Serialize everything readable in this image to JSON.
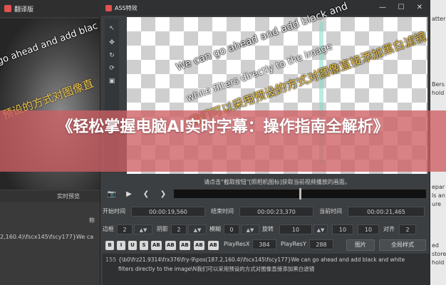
{
  "bg_app": {
    "title": "翻译版",
    "subtitle_en": "go ahead and add blac filters directly to the",
    "subtitle_cn": "预设的方式对图像直",
    "status_label": "实时预览",
    "field_label": "称",
    "code_fragment": "2,160.4)\\fscx145\\fscy177}We ca"
  },
  "bg_right": {
    "lines": [
      "atter",
      "Bers",
      "hold",
      "epar",
      "ls an",
      "ure",
      "ed",
      "store",
      "hold"
    ]
  },
  "dialog": {
    "title": "ASS特效",
    "win_min": "—",
    "win_max": "☐",
    "win_close": "✕",
    "tools": [
      "↖",
      "✥",
      "↻",
      "⟳",
      "▣"
    ]
  },
  "canvas": {
    "subtitle_line1": "We can go ahead and add black and",
    "subtitle_line2": "white filters directly to the image",
    "subtitle_line3": "我们可以采用预设的方式对图像直接添加黑白滤镜"
  },
  "hint": "请点击\"截取按钮\"[照相机图标]获取当前视频播放的画面。",
  "player": {
    "camera": "📷",
    "play": "▶",
    "prev": "❮",
    "next": "❯"
  },
  "times": {
    "start_label": "开始时间",
    "start_value": "00:00:19,560",
    "end_label": "结束时间",
    "end_value": "00:00:23,370",
    "current_label": "当前时间",
    "current_value": "00:00:21,465"
  },
  "props": {
    "border_label": "边框",
    "border_value": "2",
    "shadow_label": "阴影",
    "shadow_value": "2",
    "blur_label": "模糊",
    "blur_value": "0",
    "rotate_label": "旋转",
    "rotate_value": "10",
    "rotate_value2": "10",
    "rotate_value3": "10",
    "align_label": "对齐",
    "align_value": "2"
  },
  "format": {
    "buttons": [
      "B",
      "I",
      "U",
      "S",
      "AB",
      "AB",
      "AB",
      "AB",
      "AB"
    ],
    "playresx_label": "PlayResX",
    "playresx_value": "384",
    "playresy_label": "PlayResY",
    "playresy_value": "288",
    "image_btn": "图片",
    "fullstyle_btn": "全局样式"
  },
  "editor": {
    "line_no": "155",
    "code_line1": "{\\b0\\frz21.9314\\frx376\\fry-9\\pos(187.2,160.4)\\fscx145\\fscy177}We can go ahead and add black and white",
    "code_line2": "filters directly to the image\\N我们可以采用预设的方式对图像直接添加黑白滤镜"
  },
  "banner": {
    "title": "《轻松掌握电脑AI实时字幕：操作指南全解析》"
  },
  "colors": {
    "banner": "#cd5f64",
    "accent_yellow": "#f2c94c",
    "logo": "#e0534f"
  }
}
